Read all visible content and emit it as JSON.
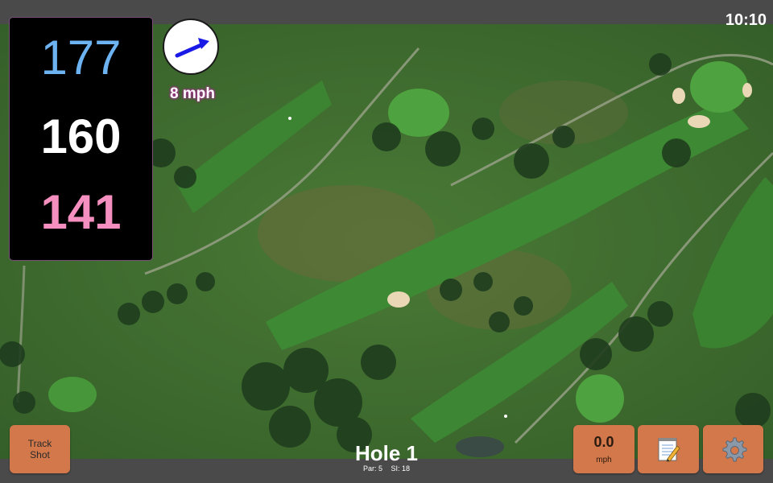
{
  "status_bar": {
    "time": "10:10"
  },
  "distances": {
    "back": "177",
    "center": "160",
    "front": "141"
  },
  "wind": {
    "speed_label": "8 mph",
    "direction_icon": "wind-arrow-icon"
  },
  "buttons": {
    "track_shot_line1": "Track",
    "track_shot_line2": "Shot",
    "wind_value": "0.0",
    "wind_unit": "mph",
    "notes_icon": "notepad-icon",
    "settings_icon": "gear-icon"
  },
  "hole": {
    "title": "Hole 1",
    "par": "Par: 5",
    "si": "SI: 18"
  },
  "colors": {
    "back_distance": "#6db3f2",
    "center_distance": "#ffffff",
    "front_distance": "#f48fbf",
    "button_bg": "#d2784a"
  }
}
